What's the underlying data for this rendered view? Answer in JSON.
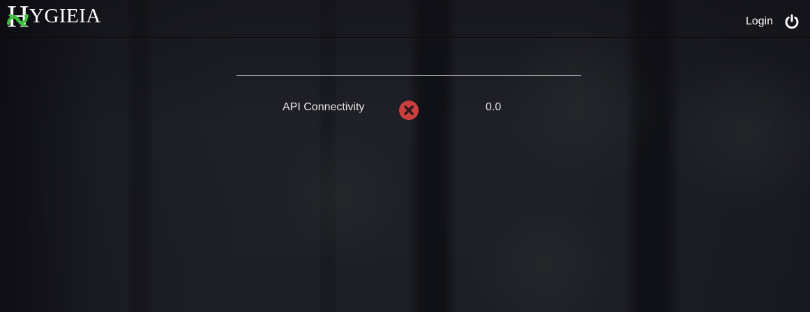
{
  "brand": {
    "title_initial": "H",
    "title_rest": "YGIEIA"
  },
  "topbar": {
    "login_label": "Login",
    "power_icon": "power-icon"
  },
  "status": {
    "items": [
      {
        "label": "API Connectivity",
        "status_icon": "error-x-icon",
        "status_color": "#c9403e",
        "value": "0.0"
      }
    ]
  },
  "colors": {
    "background": "#1c1d24",
    "brand_snake": "#3fbf3f",
    "text": "#ffffff"
  }
}
